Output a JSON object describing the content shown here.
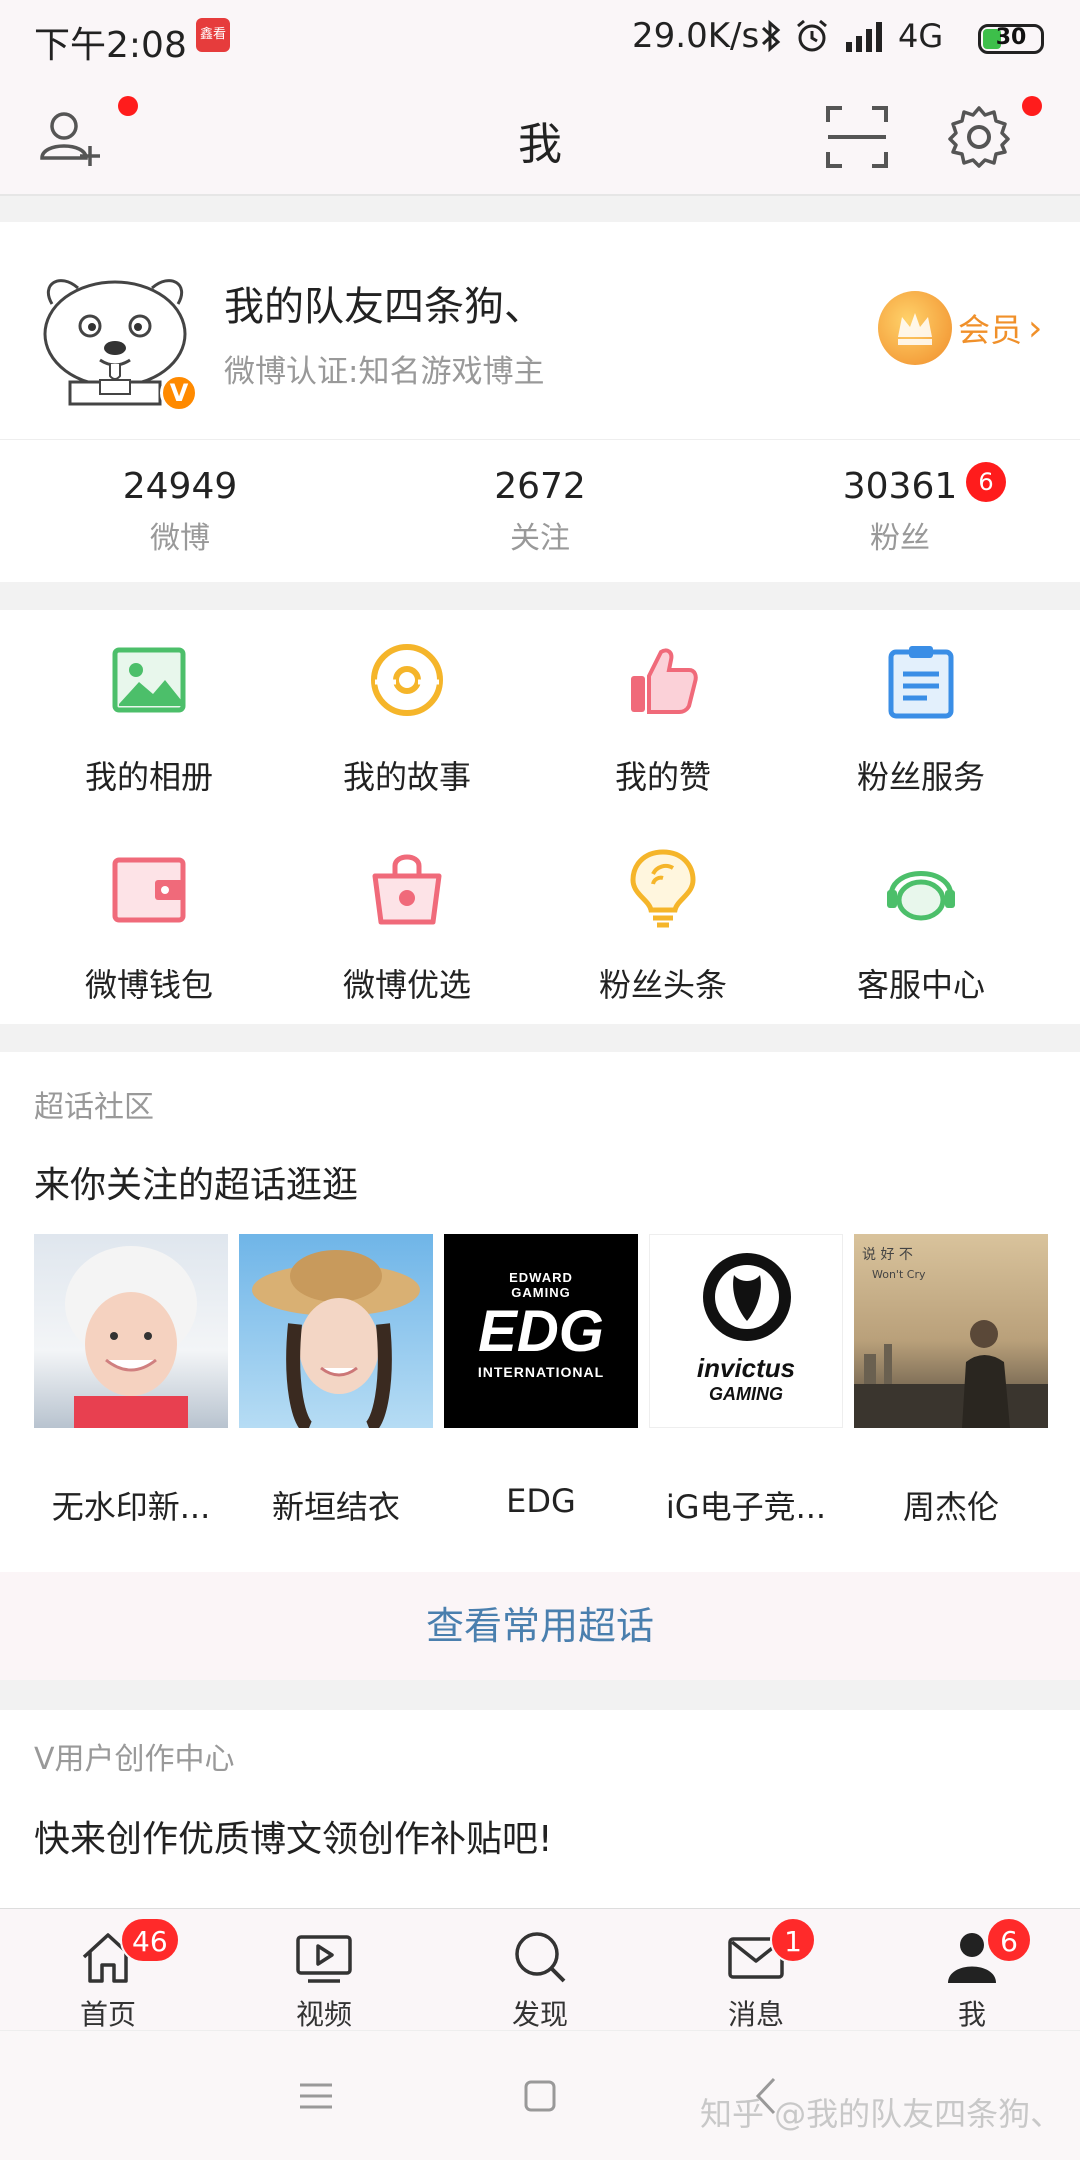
{
  "status_bar": {
    "time": "下午2:08",
    "app_badge": "鑫看",
    "net_speed": "29.0K/s",
    "network": "4G",
    "battery": "30"
  },
  "header": {
    "title": "我"
  },
  "profile": {
    "name": "我的队友四条狗、",
    "verify": "微博认证:知名游戏博主",
    "vip_label": "会员",
    "v_badge": "V"
  },
  "stats": [
    {
      "value": "24949",
      "label": "微博"
    },
    {
      "value": "2672",
      "label": "关注"
    },
    {
      "value": "30361",
      "label": "粉丝",
      "badge": "6"
    }
  ],
  "grid": [
    {
      "label": "我的相册",
      "icon": "photo-album-icon",
      "color": "#4cbf6a"
    },
    {
      "label": "我的故事",
      "icon": "story-icon",
      "color": "#f5b52a"
    },
    {
      "label": "我的赞",
      "icon": "thumbs-up-icon",
      "color": "#f06a7a"
    },
    {
      "label": "粉丝服务",
      "icon": "clipboard-icon",
      "color": "#3a8ee6"
    },
    {
      "label": "微博钱包",
      "icon": "wallet-icon",
      "color": "#f06a7a"
    },
    {
      "label": "微博优选",
      "icon": "shopping-bag-icon",
      "color": "#f06a7a"
    },
    {
      "label": "粉丝头条",
      "icon": "lightbulb-icon",
      "color": "#f5b52a"
    },
    {
      "label": "客服中心",
      "icon": "headset-icon",
      "color": "#4cbf6a"
    }
  ],
  "topics": {
    "section": "超话社区",
    "subtitle": "来你关注的超话逛逛",
    "cards": [
      {
        "label": "无水印新..."
      },
      {
        "label": "新垣结衣"
      },
      {
        "label": "EDG",
        "logo_top": "EDWARD",
        "logo_mid": "GAMING",
        "logo_big": "EDG",
        "logo_bottom": "INTERNATIONAL"
      },
      {
        "label": "iG电子竞...",
        "logo_text": "invictus",
        "logo_text2": "GAMING"
      },
      {
        "label": "周杰伦",
        "art_text": "说 好 不",
        "art_text2": "Won't Cry"
      }
    ],
    "more_label": "查看常用超话"
  },
  "creator": {
    "section": "V用户创作中心",
    "subtitle": "快来创作优质博文领创作补贴吧!"
  },
  "tabbar": [
    {
      "label": "首页",
      "icon": "home-icon",
      "badge": "46"
    },
    {
      "label": "视频",
      "icon": "video-icon",
      "badge": ""
    },
    {
      "label": "发现",
      "icon": "search-icon",
      "badge": ""
    },
    {
      "label": "消息",
      "icon": "mail-icon",
      "badge": "1"
    },
    {
      "label": "我",
      "icon": "person-icon",
      "badge": "6"
    }
  ],
  "watermark": "知乎 @我的队友四条狗、",
  "colors": {
    "accent_red": "#ff1c1c",
    "vip_orange": "#f0902a",
    "link_blue": "#4a7fae"
  }
}
